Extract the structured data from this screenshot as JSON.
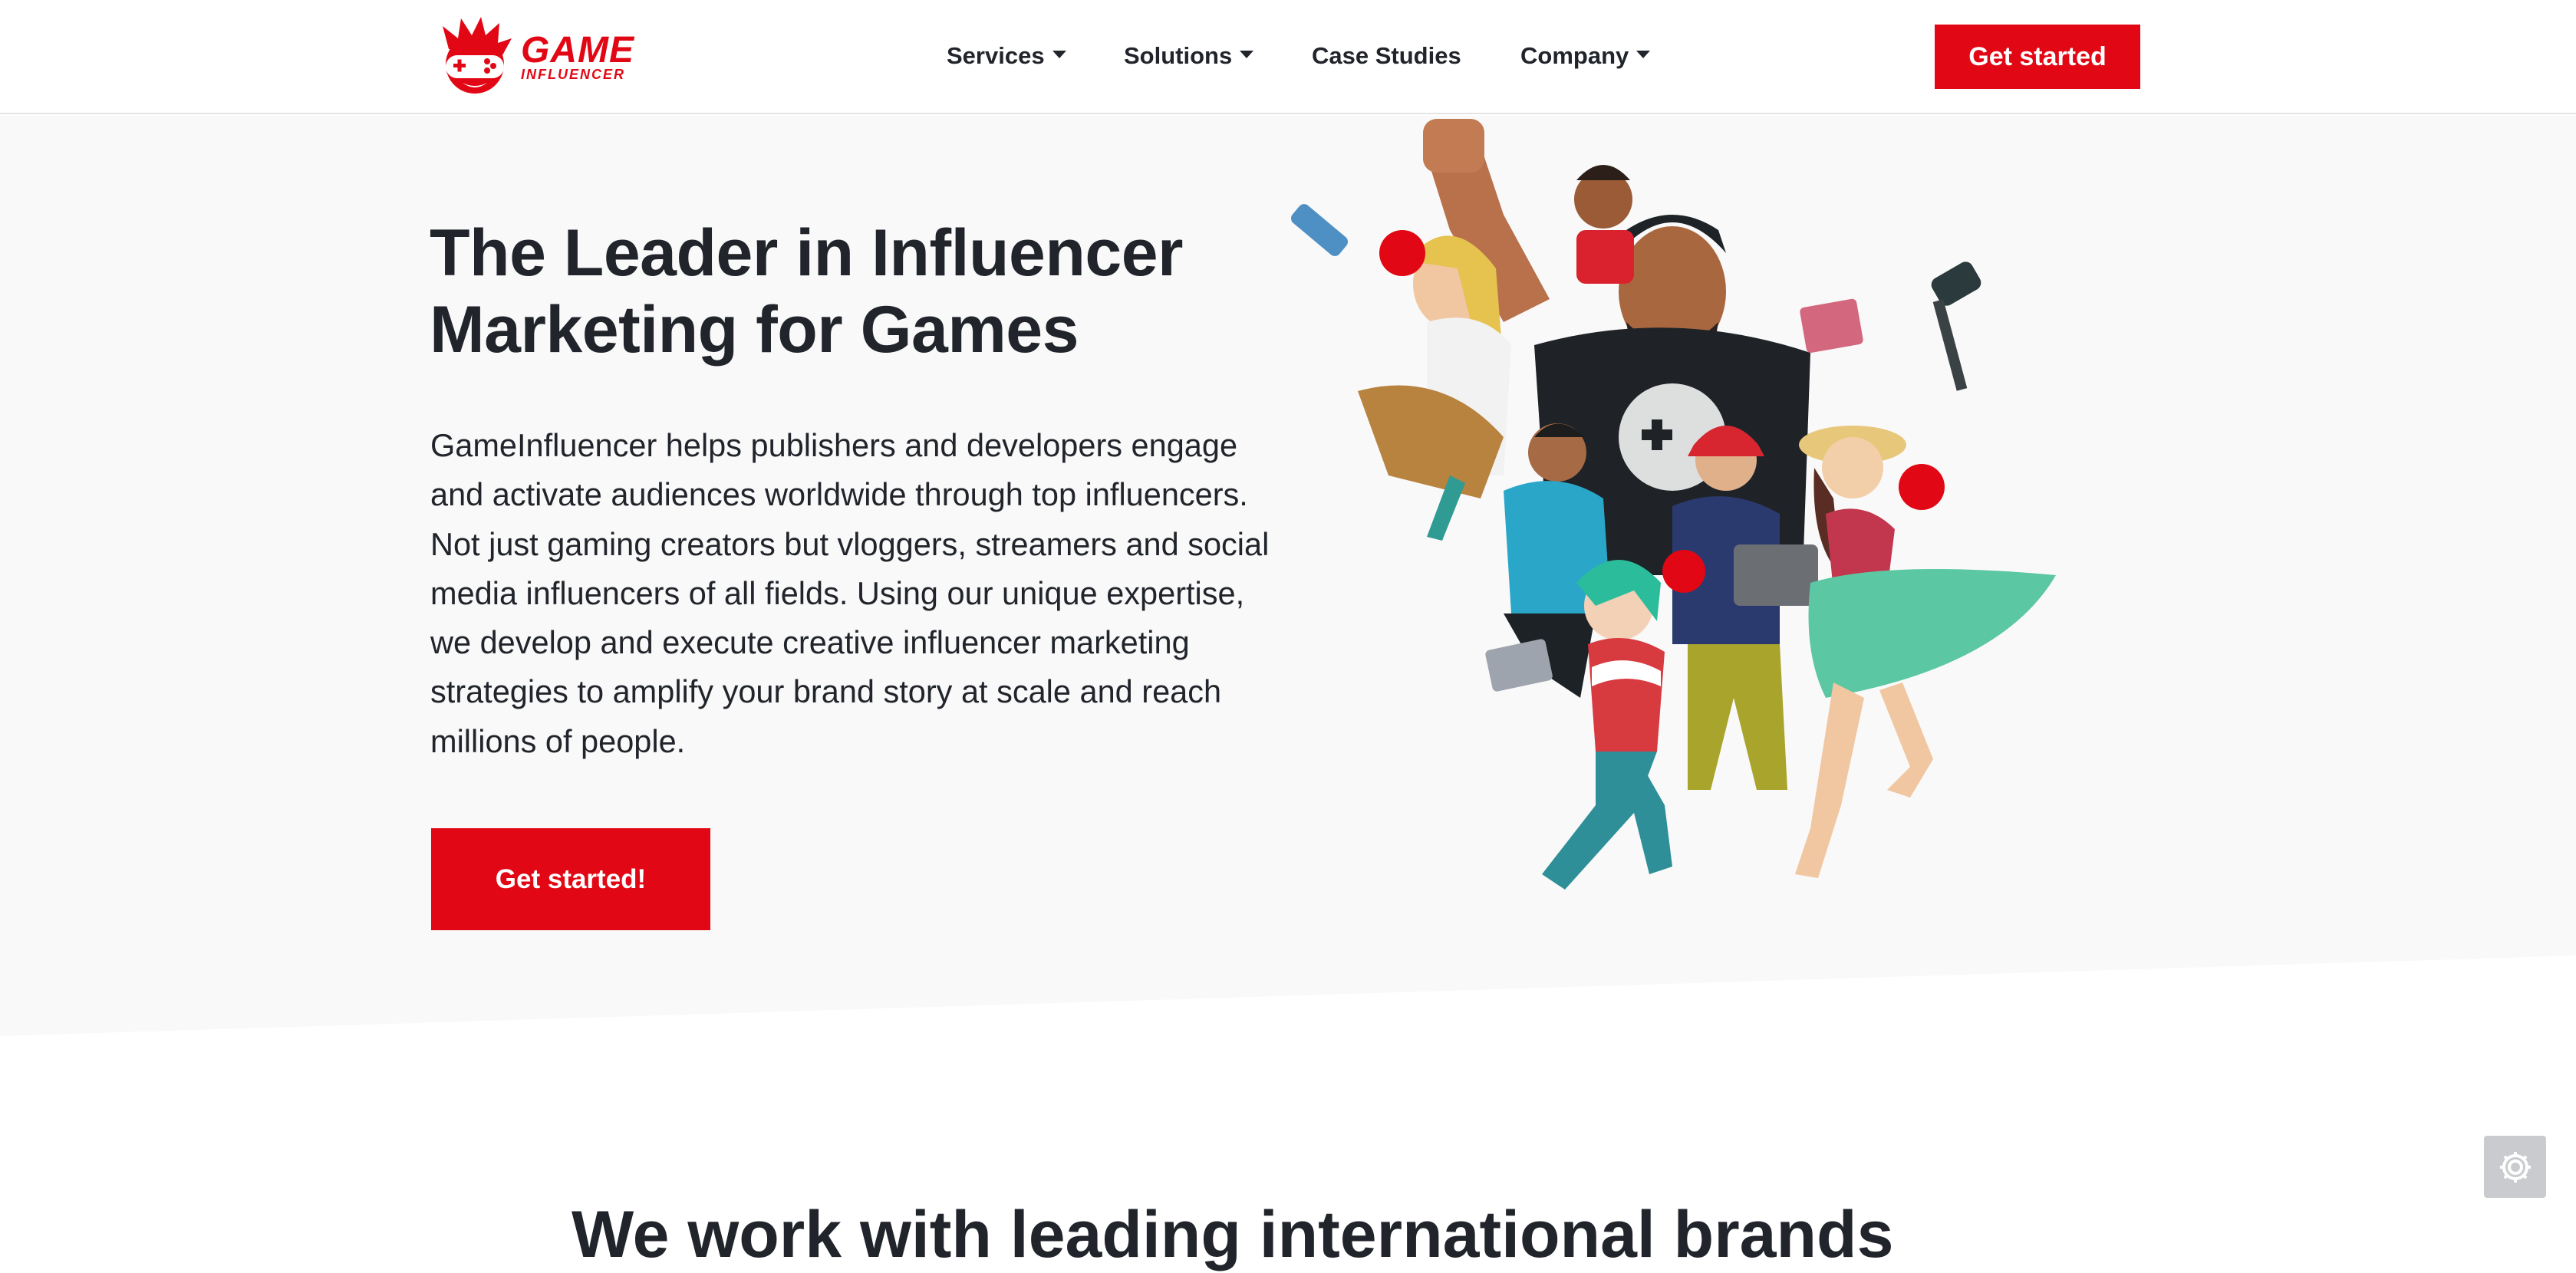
{
  "brand": {
    "logo_line1": "GAME",
    "logo_line2": "INFLUENCER",
    "accent_color": "#e10714",
    "logo_icon": "gamer-mascot-logo-icon"
  },
  "nav": {
    "items": [
      {
        "label": "Services",
        "dropdown": true
      },
      {
        "label": "Solutions",
        "dropdown": true
      },
      {
        "label": "Case Studies",
        "dropdown": false
      },
      {
        "label": "Company",
        "dropdown": true
      }
    ],
    "cta_label": "Get started"
  },
  "hero": {
    "title_line1": "The Leader in Influencer",
    "title_line2": "Marketing for Games",
    "description": "GameInfluencer helps publishers and developers engage and activate audiences worldwide through top influencers. Not just gaming creators but vloggers, streamers and social media influencers of all fields. Using our unique expertise, we develop and execute creative influencer marketing strategies to amplify your brand story at scale and reach millions of people.",
    "cta_label": "Get started!",
    "illustration_icon": "influencer-group-illustration"
  },
  "section2": {
    "title": "We work with leading international brands"
  },
  "widgets": {
    "settings_icon": "gear-icon"
  }
}
